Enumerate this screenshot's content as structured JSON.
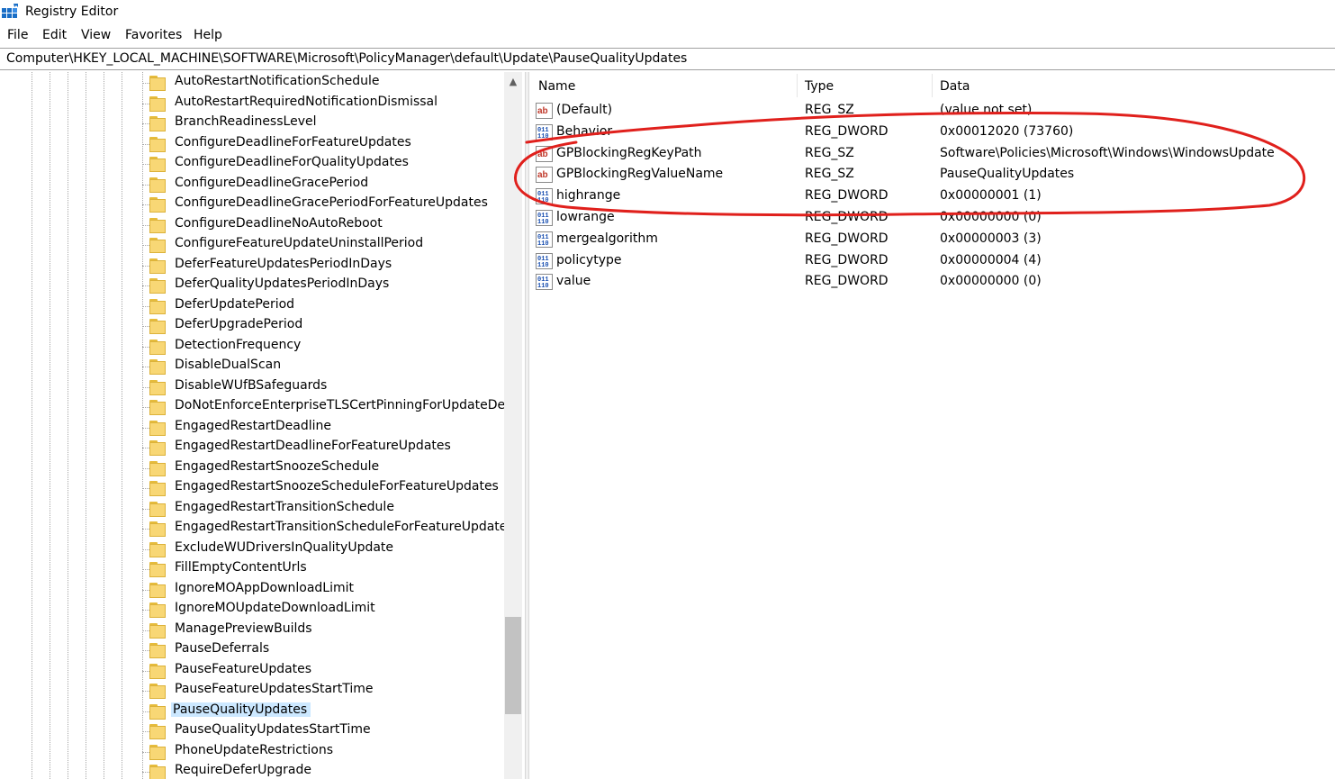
{
  "window": {
    "title": "Registry Editor",
    "icon": "registry-editor-icon"
  },
  "menu": [
    "File",
    "Edit",
    "View",
    "Favorites",
    "Help"
  ],
  "address": "Computer\\HKEY_LOCAL_MACHINE\\SOFTWARE\\Microsoft\\PolicyManager\\default\\Update\\PauseQualityUpdates",
  "tree": {
    "items": [
      "AutoRestartNotificationSchedule",
      "AutoRestartRequiredNotificationDismissal",
      "BranchReadinessLevel",
      "ConfigureDeadlineForFeatureUpdates",
      "ConfigureDeadlineForQualityUpdates",
      "ConfigureDeadlineGracePeriod",
      "ConfigureDeadlineGracePeriodForFeatureUpdates",
      "ConfigureDeadlineNoAutoReboot",
      "ConfigureFeatureUpdateUninstallPeriod",
      "DeferFeatureUpdatesPeriodInDays",
      "DeferQualityUpdatesPeriodInDays",
      "DeferUpdatePeriod",
      "DeferUpgradePeriod",
      "DetectionFrequency",
      "DisableDualScan",
      "DisableWUfBSafeguards",
      "DoNotEnforceEnterpriseTLSCertPinningForUpdateDetec",
      "EngagedRestartDeadline",
      "EngagedRestartDeadlineForFeatureUpdates",
      "EngagedRestartSnoozeSchedule",
      "EngagedRestartSnoozeScheduleForFeatureUpdates",
      "EngagedRestartTransitionSchedule",
      "EngagedRestartTransitionScheduleForFeatureUpdates",
      "ExcludeWUDriversInQualityUpdate",
      "FillEmptyContentUrls",
      "IgnoreMOAppDownloadLimit",
      "IgnoreMOUpdateDownloadLimit",
      "ManagePreviewBuilds",
      "PauseDeferrals",
      "PauseFeatureUpdates",
      "PauseFeatureUpdatesStartTime",
      "PauseQualityUpdates",
      "PauseQualityUpdatesStartTime",
      "PhoneUpdateRestrictions",
      "RequireDeferUpgrade"
    ],
    "selected": "PauseQualityUpdates",
    "scroll_position": 0.84
  },
  "columns": {
    "name": "Name",
    "type": "Type",
    "data": "Data"
  },
  "values": [
    {
      "name": "(Default)",
      "type": "REG_SZ",
      "data": "(value not set)",
      "icon": "string-value-icon"
    },
    {
      "name": "Behavior",
      "type": "REG_DWORD",
      "data": "0x00012020 (73760)",
      "icon": "binary-value-icon"
    },
    {
      "name": "GPBlockingRegKeyPath",
      "type": "REG_SZ",
      "data": "Software\\Policies\\Microsoft\\Windows\\WindowsUpdate",
      "icon": "string-value-icon"
    },
    {
      "name": "GPBlockingRegValueName",
      "type": "REG_SZ",
      "data": "PauseQualityUpdates",
      "icon": "string-value-icon"
    },
    {
      "name": "highrange",
      "type": "REG_DWORD",
      "data": "0x00000001 (1)",
      "icon": "binary-value-icon"
    },
    {
      "name": "lowrange",
      "type": "REG_DWORD",
      "data": "0x00000000 (0)",
      "icon": "binary-value-icon"
    },
    {
      "name": "mergealgorithm",
      "type": "REG_DWORD",
      "data": "0x00000003 (3)",
      "icon": "binary-value-icon"
    },
    {
      "name": "policytype",
      "type": "REG_DWORD",
      "data": "0x00000004 (4)",
      "icon": "binary-value-icon"
    },
    {
      "name": "value",
      "type": "REG_DWORD",
      "data": "0x00000000 (0)",
      "icon": "binary-value-icon"
    }
  ],
  "colors": {
    "selection": "#cce8ff",
    "folder": "#f8d775",
    "annotation": "#e0201c"
  }
}
